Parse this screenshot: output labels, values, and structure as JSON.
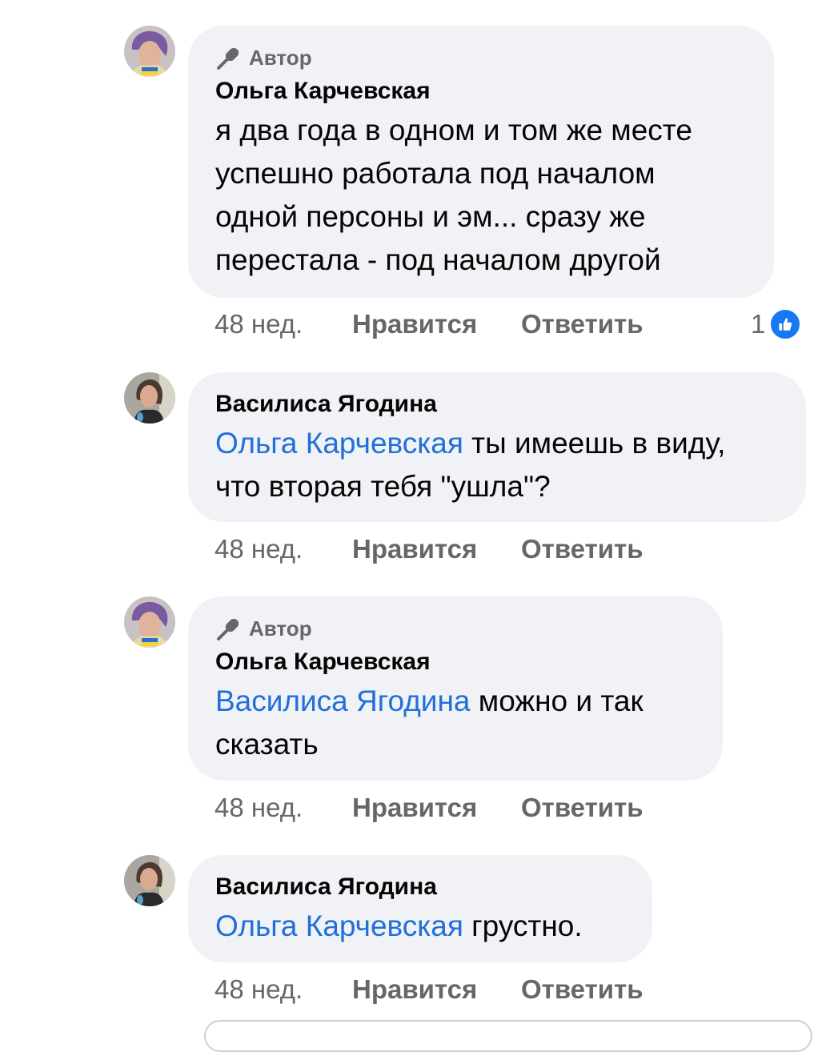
{
  "comments": [
    {
      "is_author": true,
      "badge_label": "Автор",
      "name": "Ольга Карчевская",
      "mention": "",
      "text_lines": [
        "я два года в одном и том же месте",
        "успешно работала под началом",
        "одной персоны и эм... сразу же",
        "перестала - под началом другой"
      ],
      "time": "48 нед.",
      "like_label": "Нравится",
      "reply_label": "Ответить",
      "reaction_count": "1"
    },
    {
      "is_author": false,
      "name": "Василиса Ягодина",
      "mention": "Ольга Карчевская",
      "text_after_mention": " ты имеешь в виду,",
      "text_line2": "что вторая тебя \"ушла\"?",
      "time": "48 нед.",
      "like_label": "Нравится",
      "reply_label": "Ответить"
    },
    {
      "is_author": true,
      "badge_label": "Автор",
      "name": "Ольга Карчевская",
      "mention": "Василиса Ягодина",
      "text_after_mention": " можно и так",
      "text_line2": "сказать",
      "time": "48 нед.",
      "like_label": "Нравится",
      "reply_label": "Ответить"
    },
    {
      "is_author": false,
      "name": "Василиса Ягодина",
      "mention": "Ольга Карчевская",
      "text_after_mention": " грустно.",
      "time": "48 нед.",
      "like_label": "Нравится",
      "reply_label": "Ответить"
    }
  ],
  "colors": {
    "bubble": "#f0f2f5",
    "mention": "#216fdb",
    "meta": "#65676b",
    "like_badge": "#1877f2"
  },
  "icons": {
    "author_badge": "microphone-icon",
    "reaction": "thumbs-up-icon"
  }
}
